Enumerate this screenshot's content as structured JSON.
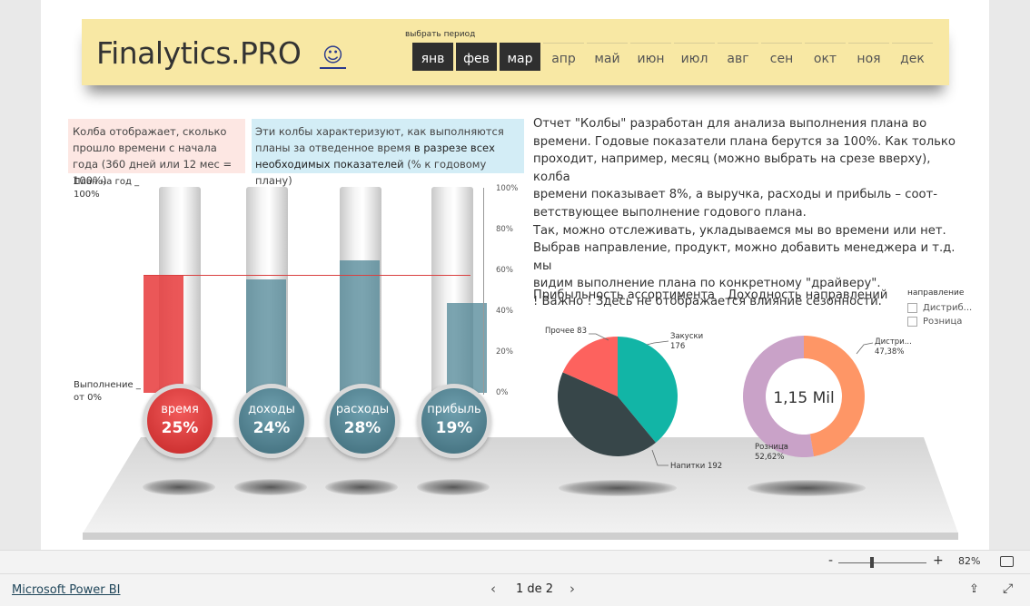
{
  "header": {
    "brand": "Finalytics.PRO",
    "smiley": "☺",
    "period_label": "выбрать период",
    "months": [
      {
        "label": "янв",
        "selected": true
      },
      {
        "label": "фев",
        "selected": true
      },
      {
        "label": "мар",
        "selected": true
      },
      {
        "label": "апр",
        "selected": false
      },
      {
        "label": "май",
        "selected": false
      },
      {
        "label": "июн",
        "selected": false
      },
      {
        "label": "июл",
        "selected": false
      },
      {
        "label": "авг",
        "selected": false
      },
      {
        "label": "сен",
        "selected": false
      },
      {
        "label": "окт",
        "selected": false
      },
      {
        "label": "ноя",
        "selected": false
      },
      {
        "label": "дек",
        "selected": false
      }
    ]
  },
  "info": {
    "pink_text": "Колба отображает, сколько прошло времени с начала года (360 дней или 12 мес = 100%)",
    "blue_text_a": "Эти колбы характеризуют, как выполняются планы за отведенное время ",
    "blue_text_b": "в разрезе всех необходимых показателей",
    "blue_text_c": " (% к годовому плану)"
  },
  "description": [
    "Отчет \"Колбы\" разработан для анализа выполнения плана во",
    "времени. Годовые показатели плана берутся за 100%. Как только",
    "проходит, например, месяц (можно выбрать на срезе вверху), колба",
    "времени показывает 8%, а выручка, расходы и прибыль – соот-",
    "ветствующее выполнение годового плана.",
    "Так, можно отслеживать, укладываемся мы во времени или нет.",
    "Выбрав направление, продукт, можно добавить менеджера и т.д. мы",
    "видим выполнение плана по конкретному \"драйверу\".",
    "! Важно ! Здесь не отображается влияние сезонности."
  ],
  "flasks": {
    "plan_label_1": "План на год _",
    "plan_label_2": "100%",
    "exec_label_1": "Выполнение _",
    "exec_label_2": "от 0%",
    "axis_ticks": [
      "100%",
      "80%",
      "60%",
      "40%",
      "20%",
      "0%"
    ],
    "items": [
      {
        "name": "время",
        "pct_label": "25%",
        "value": 25,
        "color": "#e8393b"
      },
      {
        "name": "доходы",
        "pct_label": "24%",
        "value": 24,
        "color": "#4f8596"
      },
      {
        "name": "расходы",
        "pct_label": "28%",
        "value": 28,
        "color": "#4f8596"
      },
      {
        "name": "прибыль",
        "pct_label": "19%",
        "value": 19,
        "color": "#4f8596"
      }
    ]
  },
  "chart_data": [
    {
      "type": "pie",
      "title": "Прибыльность ассортимента",
      "categories": [
        "Закуски",
        "Напитки",
        "Прочее"
      ],
      "values": [
        176,
        192,
        83
      ],
      "labels": [
        "Закуски 176",
        "Напитки 192",
        "Прочее 83"
      ],
      "colors": [
        "#12b5a6",
        "#374649",
        "#fd625e"
      ]
    },
    {
      "type": "donut",
      "title": "Доходность направлений",
      "categories": [
        "Дистри...",
        "Розница"
      ],
      "values": [
        47.38,
        52.62
      ],
      "labels": [
        "Дистри... 47,38%",
        "Розница 52,62%"
      ],
      "center_label": "1,15 Mil",
      "colors": [
        "#fe9666",
        "#c9a2c8"
      ]
    }
  ],
  "legend": {
    "title": "направление",
    "items": [
      "Дистриб...",
      "Розница"
    ]
  },
  "footer": {
    "app_link": "Microsoft Power BI",
    "page_indicator": "1 de 2",
    "zoom": "82%"
  }
}
